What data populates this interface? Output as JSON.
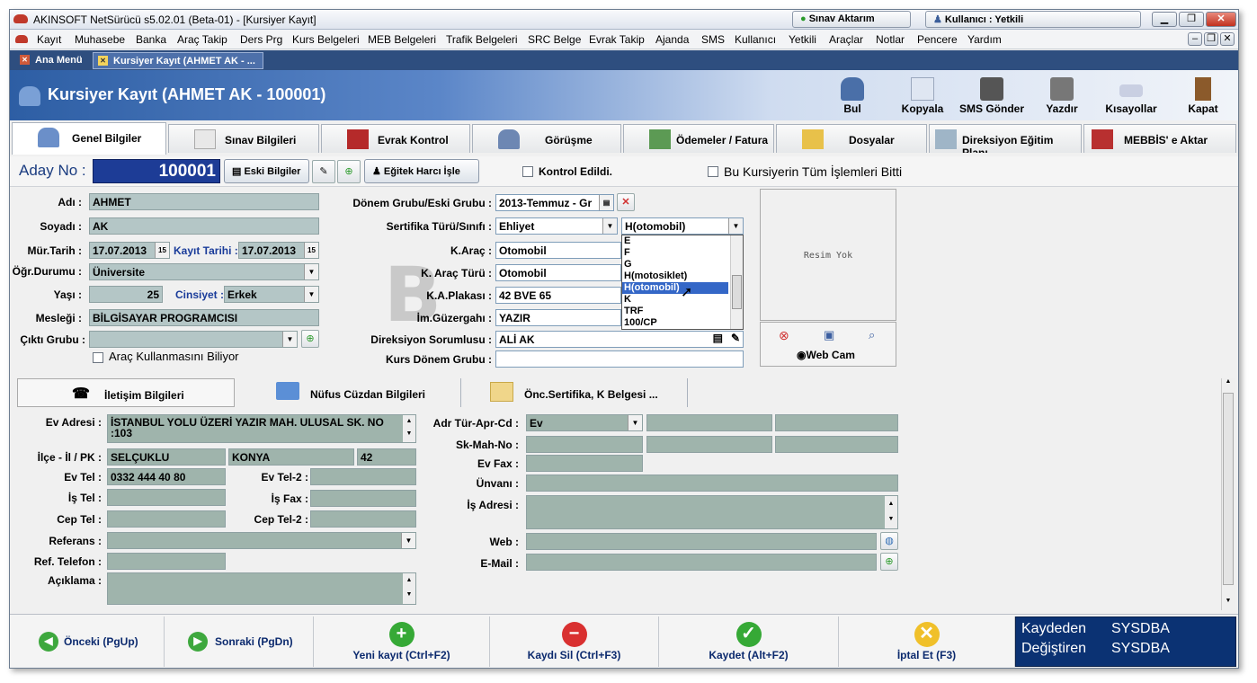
{
  "window": {
    "title": "AKINSOFT NetSürücü s5.02.01 (Beta-01) - [Kursiyer Kayıt]",
    "btn_sinav": "Sınav Aktarım",
    "btn_user": "Kullanıcı : Yetkili"
  },
  "menu": [
    "Kayıt",
    "Muhasebe",
    "Banka",
    "Araç Takip",
    "Ders Prg",
    "Kurs Belgeleri",
    "MEB Belgeleri",
    "Trafik Belgeleri",
    "SRC Belge",
    "Evrak Takip",
    "Ajanda",
    "SMS",
    "Kullanıcı",
    "Yetkili",
    "Araçlar",
    "Notlar",
    "Pencere",
    "Yardım"
  ],
  "doc_tabs": [
    "Ana Menü",
    "Kursiyer Kayıt (AHMET AK - ..."
  ],
  "header": {
    "title": "Kursiyer Kayıt (AHMET AK - 100001)",
    "buttons": [
      "Bul",
      "Kopyala",
      "SMS Gönder",
      "Yazdır",
      "Kısayollar",
      "Kapat"
    ]
  },
  "main_tabs": [
    "Genel Bilgiler",
    "Sınav Bilgileri",
    "Evrak Kontrol",
    "Görüşme",
    "Ödemeler / Fatura",
    "Dosyalar",
    "Direksiyon Eğitim Planı",
    "MEBBİS' e Aktar"
  ],
  "row2": {
    "aday_label": "Aday No :",
    "aday_no": "100001",
    "eski": "Eski Bilgiler",
    "egitek": "Eğitek Harcı İşle",
    "kontrol": "Kontrol Edildi.",
    "bitti": "Bu Kursiyerin Tüm İşlemleri Bitti"
  },
  "form": {
    "adi_l": "Adı :",
    "adi": "AHMET",
    "soyadi_l": "Soyadı :",
    "soyadi": "AK",
    "mur_l": "Mür.Tarih :",
    "mur": "17.07.2013",
    "kayit_l": "Kayıt Tarihi :",
    "kayit": "17.07.2013",
    "ogr_l": "Öğr.Durumu :",
    "ogr": "Üniversite",
    "yas_l": "Yaşı :",
    "yas": "25",
    "cins_l": "Cinsiyet :",
    "cins": "Erkek",
    "meslek_l": "Mesleği :",
    "meslek": "BİLGİSAYAR PROGRAMCISI",
    "cikti_l": "Çıktı Grubu :",
    "arac_kul": "Araç Kullanmasını Biliyor",
    "donem_l": "Dönem Grubu/Eski Grubu :",
    "donem": "2013-Temmuz - Gr",
    "sert_l": "Sertifika Türü/Sınıfı :",
    "sert": "Ehliyet",
    "sinif": "H(otomobil)",
    "karac_l": "K.Araç :",
    "karac": "Otomobil",
    "kturu_l": "K. Araç Türü :",
    "kturu": "Otomobil",
    "plaka_l": "K.A.Plakası :",
    "plaka": "42 BVE 65",
    "guz_l": "İm.Güzergahı :",
    "guz": "YAZIR",
    "dir_l": "Direksiyon Sorumlusu :",
    "dir": "ALİ AK",
    "kdonem_l": "Kurs Dönem Grubu :",
    "resim": "Resim Yok",
    "webcam": "Web Cam",
    "dropdown": [
      "E",
      "F",
      "G",
      "H(motosiklet)",
      "H(otomobil)",
      "K",
      "TRF",
      "100/CP"
    ]
  },
  "sub_tabs": [
    "İletişim Bilgileri",
    "Nüfus Cüzdan Bilgileri",
    "Önc.Sertifika, K Belgesi ..."
  ],
  "contact": {
    "ev_adres_l": "Ev Adresi :",
    "ev_adres": "İSTANBUL YOLU ÜZERİ YAZIR MAH. ULUSAL SK. NO :103",
    "ilce_l": "İlçe - İl / PK :",
    "ilce": "SELÇUKLU",
    "il": "KONYA",
    "pk": "42",
    "evtel_l": "Ev Tel :",
    "evtel": "0332 444 40 80",
    "evtel2_l": "Ev Tel-2 :",
    "istel_l": "İş Tel :",
    "isfax_l": "İş Fax :",
    "ceptel_l": "Cep Tel :",
    "ceptel2_l": "Cep Tel-2 :",
    "ref_l": "Referans :",
    "reftel_l": "Ref. Telefon :",
    "acik_l": "Açıklama :",
    "adr_l": "Adr Tür-Apr-Cd :",
    "adr": "Ev",
    "sk_l": "Sk-Mah-No :",
    "evfax_l": "Ev Fax :",
    "unvan_l": "Ünvanı :",
    "isadr_l": "İş Adresi :",
    "web_l": "Web :",
    "email_l": "E-Mail :"
  },
  "bottom": {
    "onceki": "Önceki (PgUp)",
    "sonraki": "Sonraki (PgDn)",
    "yeni": "Yeni kayıt (Ctrl+F2)",
    "sil": "Kaydı Sil (Ctrl+F3)",
    "kaydet": "Kaydet (Alt+F2)",
    "iptal": "İptal Et (F3)",
    "kaydeden_l": "Kaydeden",
    "kaydeden": "SYSDBA",
    "degistiren_l": "Değiştiren",
    "degistiren": "SYSDBA"
  }
}
